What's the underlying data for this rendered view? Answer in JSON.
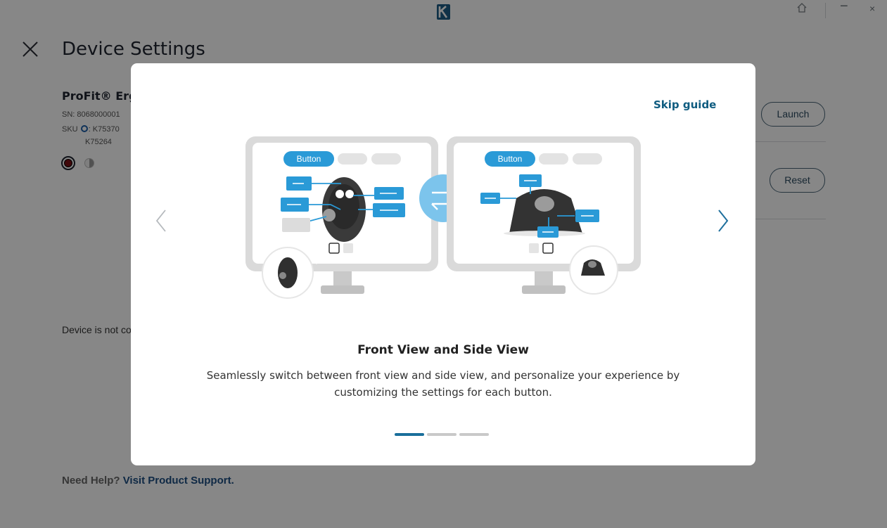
{
  "titlebar": {
    "logo_letter": "K",
    "home_icon": "home-icon",
    "minimize_label": "−",
    "close_label": "×"
  },
  "page": {
    "title": "Device Settings",
    "close_icon": "close-icon"
  },
  "device": {
    "name": "ProFit® Erg",
    "sn": "SN: 8068000001",
    "sku_prefix": "SKU",
    "sku1": ": K75370",
    "sku2": "K75264",
    "status": "Device is not co"
  },
  "actions": {
    "launch_label": "Launch",
    "reset_label": "Reset"
  },
  "help": {
    "prefix": "Need Help?",
    "link": "Visit Product Support."
  },
  "guide": {
    "skip_label": "Skip guide",
    "slide_title": "Front View and Side View",
    "slide_description": "Seamlessly switch between front view and side view, and personalize your experience by customizing the settings for each button.",
    "illustration": {
      "left_tab": "Button",
      "right_tab": "Button",
      "placeholder": "— —"
    },
    "pagination": {
      "total": 3,
      "active": 1
    }
  },
  "colors": {
    "accent": "#1a6f9b",
    "link": "#0f5c80",
    "callout_blue": "#2a9ad7"
  }
}
